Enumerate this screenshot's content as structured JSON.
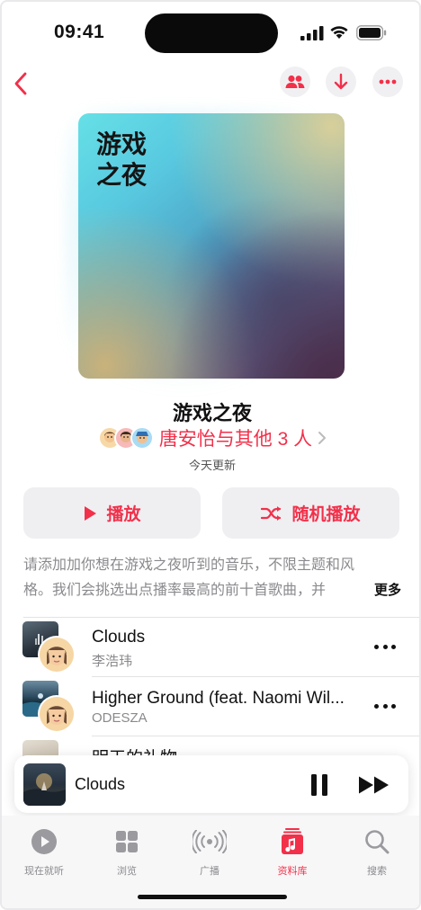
{
  "status_bar": {
    "time": "09:41"
  },
  "nav": {
    "back_icon": "chevron-left-icon",
    "actions": [
      "people-icon",
      "download-icon",
      "more-icon"
    ]
  },
  "artwork": {
    "title": "游戏\n之夜"
  },
  "playlist": {
    "title": "游戏之夜",
    "curator": "唐安怡与其他 3 人",
    "updated": "今天更新",
    "description": "请添加加你想在游戏之夜听到的音乐，不限主题和风格。我们会挑选出点播率最高的前十首歌曲，并",
    "more_label": "更多"
  },
  "actions": {
    "play_label": "播放",
    "shuffle_label": "随机播放"
  },
  "tracks": [
    {
      "title": "Clouds",
      "artist": "李浩玮"
    },
    {
      "title": "Higher Ground (feat. Naomi Wil...",
      "artist": "ODESZA"
    },
    {
      "title": "明天的礼物",
      "artist": ""
    }
  ],
  "now_playing": {
    "title": "Clouds"
  },
  "tabs": [
    {
      "label": "现在就听",
      "icon": "play-circle-icon"
    },
    {
      "label": "浏览",
      "icon": "grid-icon"
    },
    {
      "label": "广播",
      "icon": "radio-icon"
    },
    {
      "label": "资料库",
      "icon": "library-icon",
      "active": true
    },
    {
      "label": "搜索",
      "icon": "search-icon"
    }
  ],
  "colors": {
    "accent": "#f2304a",
    "secondary_text": "#8a8a8e",
    "button_bg": "#efeff2"
  }
}
